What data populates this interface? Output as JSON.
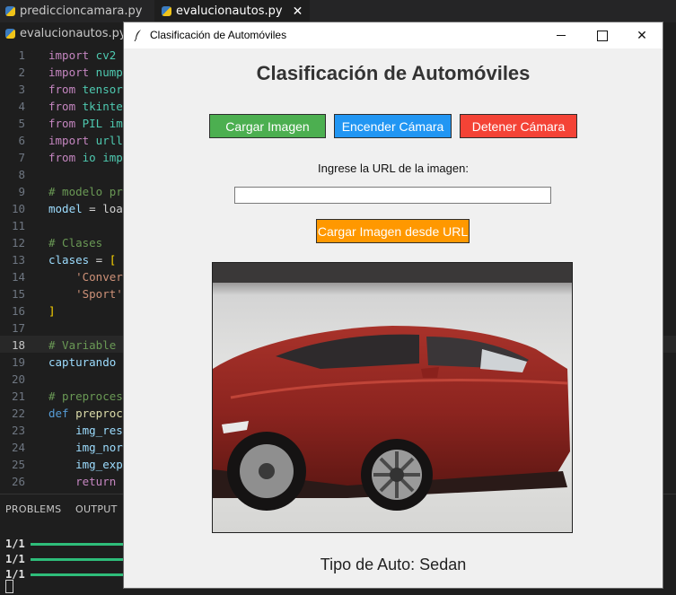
{
  "editor": {
    "tabs": [
      {
        "label": "prediccioncamara.py",
        "active": false
      },
      {
        "label": "evalucionautos.py",
        "active": true
      }
    ],
    "tab_close_glyph": "✕",
    "breadcrumb": {
      "file": "evalucionautos.py",
      "separator": ">"
    },
    "line_numbers": [
      "1",
      "2",
      "3",
      "4",
      "5",
      "6",
      "7",
      "8",
      "9",
      "10",
      "11",
      "12",
      "13",
      "14",
      "15",
      "16",
      "17",
      "18",
      "19",
      "20",
      "21",
      "22",
      "23",
      "24",
      "25",
      "26"
    ],
    "current_line": "18",
    "code": {
      "l1": [
        "import",
        " cv2"
      ],
      "l2": [
        "import",
        " numpy"
      ],
      "l3": [
        "from",
        " tensor"
      ],
      "l4": [
        "from",
        " tkinte"
      ],
      "l5": [
        "from",
        " PIL im"
      ],
      "l6": [
        "import",
        " urll"
      ],
      "l7": [
        "from",
        " io imp"
      ],
      "l9": "# modelo pr",
      "l10": [
        "model",
        " = loa"
      ],
      "l12": "# Clases",
      "l13": [
        "clases",
        " = ",
        "["
      ],
      "l14": "    'Conver",
      "l15": "    'Sport'",
      "l16": "]",
      "l18": "# Variable",
      "l19": "capturando",
      "l21": "# preproces",
      "l22": [
        "def",
        " preproc"
      ],
      "l23": "    img_res",
      "l24": "    img_nor",
      "l25": "    img_exp",
      "l26": [
        "    ",
        "return"
      ]
    },
    "panel": {
      "tabs": [
        "PROBLEMS",
        "OUTPUT"
      ],
      "lines": [
        "1/1",
        "1/1",
        "1/1"
      ]
    }
  },
  "window": {
    "title": "Clasificación de Automóviles",
    "controls": {
      "minimize": "–",
      "maximize": "□",
      "close": "✕"
    },
    "heading": "Clasificación de Automóviles",
    "buttons": {
      "load_image": "Cargar Imagen",
      "start_camera": "Encender Cámara",
      "stop_camera": "Detener Cámara",
      "load_from_url": "Cargar Imagen desde URL"
    },
    "url_label": "Ingrese la URL de la imagen:",
    "url_value": "",
    "result": "Tipo de Auto: Sedan"
  },
  "colors": {
    "green_button": "#4caf50",
    "blue_button": "#2196f3",
    "red_button": "#f44336",
    "orange_button": "#ff9800",
    "progress_green": "#2ebd7a"
  },
  "icons": [
    "python-file-icon",
    "feather-icon",
    "minimize-icon",
    "maximize-icon",
    "close-icon"
  ]
}
